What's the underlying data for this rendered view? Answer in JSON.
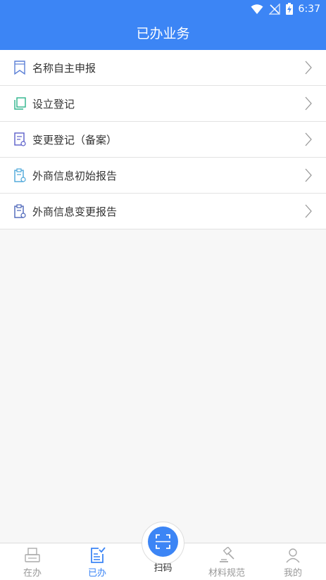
{
  "status": {
    "time": "6:37"
  },
  "header": {
    "title": "已办业务"
  },
  "list": {
    "items": [
      {
        "label": "名称自主申报",
        "icon": "bookmark-icon"
      },
      {
        "label": "设立登记",
        "icon": "copy-pages-icon"
      },
      {
        "label": "变更登记（备案）",
        "icon": "edit-document-icon"
      },
      {
        "label": "外商信息初始报告",
        "icon": "clipboard-icon"
      },
      {
        "label": "外商信息变更报告",
        "icon": "clipboard-change-icon"
      }
    ]
  },
  "tabbar": {
    "tabs": [
      {
        "label": "在办",
        "icon": "printer-icon",
        "active": false
      },
      {
        "label": "已办",
        "icon": "checked-doc-icon",
        "active": true
      },
      {
        "label": "扫码",
        "icon": "scan-icon",
        "active": false
      },
      {
        "label": "材料规范",
        "icon": "gavel-icon",
        "active": false
      },
      {
        "label": "我的",
        "icon": "person-icon",
        "active": false
      }
    ]
  },
  "colors": {
    "accent": "#3c85f5",
    "background": "#f7f7f7",
    "divider": "#e2e2e2"
  }
}
